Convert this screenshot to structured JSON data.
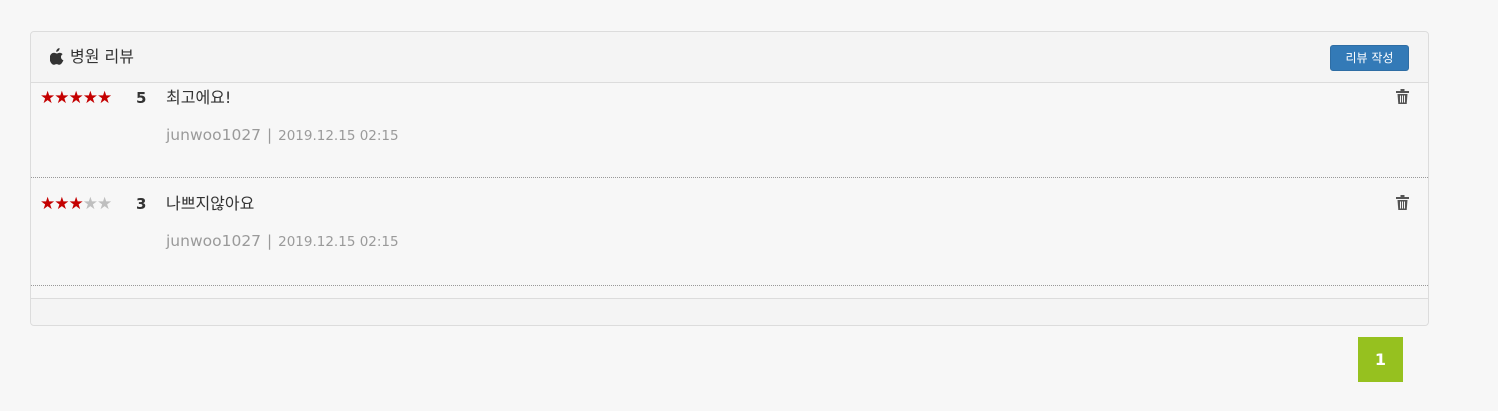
{
  "header": {
    "icon": "apple-icon",
    "title": "병원 리뷰",
    "write_button": "리뷰 작성"
  },
  "reviews": [
    {
      "rating": 5,
      "stars": {
        "on": "★★★★★",
        "off": ""
      },
      "score": "5",
      "text": "최고에요!",
      "author": "junwoo1027",
      "separator": "|",
      "date": "2019.12.15 02:15",
      "delete_icon": "trash-icon"
    },
    {
      "rating": 3,
      "stars": {
        "on": "★★★",
        "off": "★★"
      },
      "score": "3",
      "text": "나쁘지않아요",
      "author": "junwoo1027",
      "separator": "|",
      "date": "2019.12.15 02:15",
      "delete_icon": "trash-icon"
    }
  ],
  "pagination": {
    "current_page": "1"
  },
  "colors": {
    "star_on": "#c40000",
    "star_off": "#bfbfbf",
    "button_primary": "#337ab7",
    "page_active": "#96c11f",
    "meta_text": "#9a9a9a"
  }
}
